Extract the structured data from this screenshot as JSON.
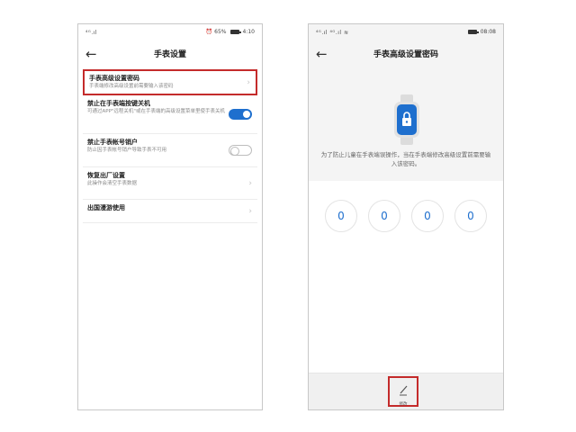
{
  "left": {
    "status": {
      "signal": "ᵛ⁴ᴳ‥′",
      "battery_pct": "65%",
      "time": "4:10"
    },
    "title": "手表设置",
    "back_icon": "arrow-left-icon",
    "items": [
      {
        "title": "手表高级设置密码",
        "sub": "手表端修改高级设置前需要输入该密码",
        "control": "chevron"
      },
      {
        "title": "禁止在手表端按键关机",
        "sub": "可通过APP\"远程关机\"或在手表端的高级设置菜单里使手表关机",
        "control": "toggle",
        "state": "on"
      },
      {
        "title": "禁止手表帐号销户",
        "sub": "防止因手表帐号销户导致手表不可用",
        "control": "toggle",
        "state": "off"
      },
      {
        "title": "恢复出厂设置",
        "sub": "此操作会清空手表数据",
        "control": "chevron"
      },
      {
        "title": "出国漫游使用",
        "sub": "",
        "control": "chevron"
      }
    ],
    "highlight_color": "#c42b2b",
    "toggle_color": "#1e6fce"
  },
  "right": {
    "status": {
      "signal": "⁴ᴳ ⁴ᴳ",
      "time": "08:08"
    },
    "title": "手表高级设置密码",
    "back_icon": "arrow-left-icon",
    "watch_icon": "watch-lock-icon",
    "description": "为了防止儿童在手表端误操作，当在手表端修改高级设置前需要输入该密码。",
    "digits": [
      "0",
      "0",
      "0",
      "0"
    ],
    "edit_label": "修改",
    "edit_icon": "pencil-icon",
    "accent_color": "#1e6fce"
  }
}
